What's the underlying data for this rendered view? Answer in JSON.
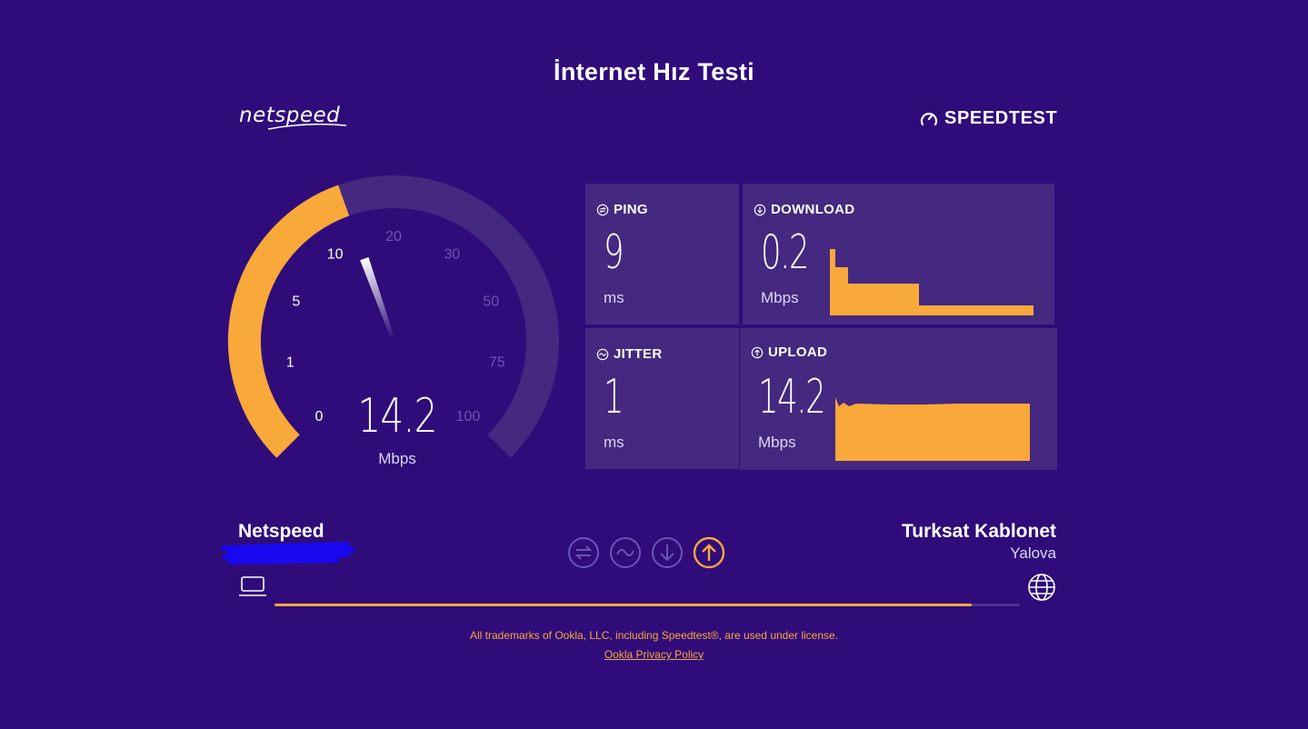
{
  "page": {
    "title": "İnternet Hız Testi"
  },
  "branding": {
    "left_logo": "netspeed",
    "right_logo": "SPEEDTEST"
  },
  "gauge": {
    "value": "14.2",
    "unit": "Mbps",
    "scale_labels": [
      "0",
      "1",
      "5",
      "10",
      "20",
      "30",
      "50",
      "75",
      "100"
    ],
    "needle_value": 14.2,
    "max_value": 100
  },
  "metrics": {
    "ping": {
      "label": "PING",
      "value": "9",
      "unit": "ms"
    },
    "jitter": {
      "label": "JITTER",
      "value": "1",
      "unit": "ms"
    },
    "download": {
      "label": "DOWNLOAD",
      "value": "0.2",
      "unit": "Mbps"
    },
    "upload": {
      "label": "UPLOAD",
      "value": "14.2",
      "unit": "Mbps"
    }
  },
  "connection": {
    "client_isp": "Netspeed",
    "server_name": "Turksat Kablonet",
    "server_city": "Yalova"
  },
  "progress": {
    "fraction": 0.935
  },
  "stages": [
    "ping-icon",
    "jitter-icon",
    "download-icon",
    "upload-icon"
  ],
  "active_stage": "upload",
  "footer": {
    "notice": "All trademarks of Ookla, LLC, including Speedtest®, are used under license.",
    "privacy_link": "Ookla Privacy Policy"
  },
  "colors": {
    "background": "#2f0c7a",
    "card": "#45287f",
    "accent": "#f9a83a",
    "track": "#4c3290",
    "muted_text": "#6c54b5"
  }
}
